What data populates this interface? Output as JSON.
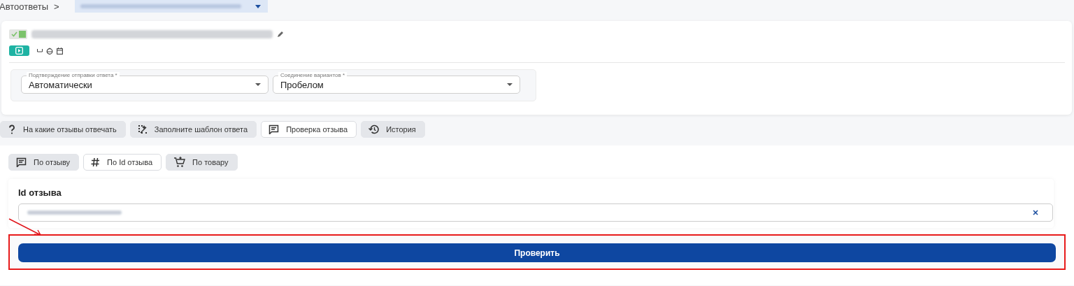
{
  "breadcrumb": {
    "label": "Автоответы",
    "separator": ">"
  },
  "rule": {
    "enabled": true
  },
  "settings": [
    {
      "label": "Подтверждение отправки ответа *",
      "value": "Автоматически"
    },
    {
      "label": "Соединение вариантов *",
      "value": "Пробелом"
    }
  ],
  "tabs": [
    {
      "label": "На какие отзывы отвечать",
      "kind": "question",
      "selected": false
    },
    {
      "label": "Заполните шаблон ответа",
      "kind": "template",
      "selected": false
    },
    {
      "label": "Проверка отзыва",
      "kind": "comment",
      "selected": true
    },
    {
      "label": "История",
      "kind": "history",
      "selected": false
    }
  ],
  "check_modes": [
    {
      "label": "По отзыву",
      "kind": "comment",
      "selected": false
    },
    {
      "label": "По Id отзыва",
      "kind": "hash",
      "selected": true
    },
    {
      "label": "По товару",
      "kind": "cart",
      "selected": false
    }
  ],
  "review_id": {
    "label": "Id отзыва"
  },
  "check_button": {
    "label": "Проверить"
  }
}
